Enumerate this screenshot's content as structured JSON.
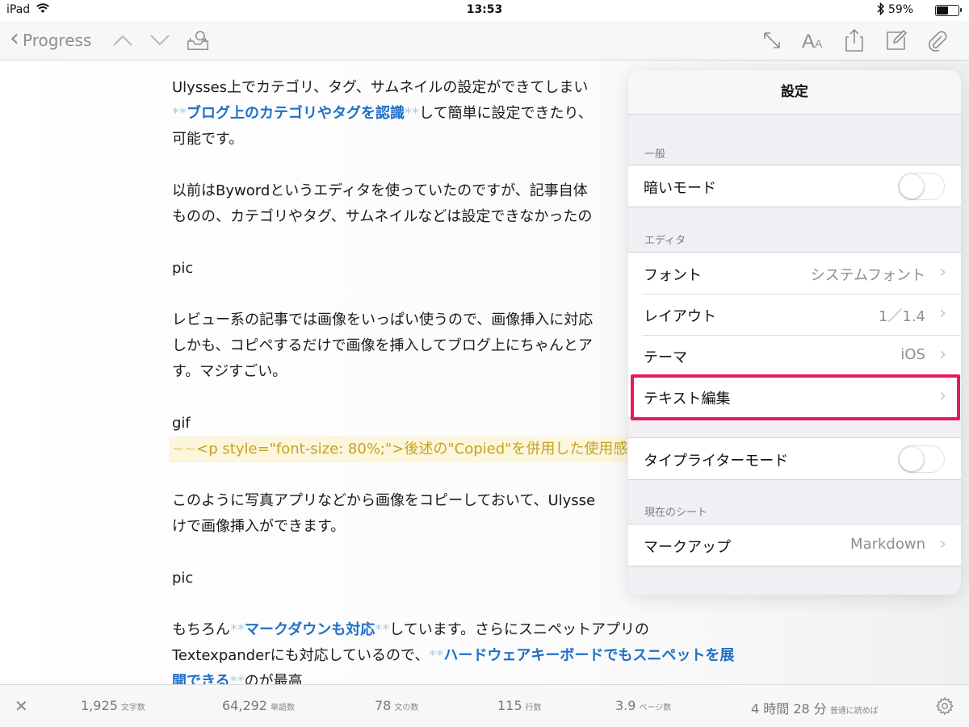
{
  "status_bar": {
    "device": "iPad",
    "time": "13:53",
    "battery": "59%",
    "battery_level": 0.59
  },
  "toolbar": {
    "back_label": "Progress",
    "icons": [
      "chevron-left-icon",
      "chevron-up-icon",
      "chevron-down-icon",
      "tray-search-icon",
      "expand-icon",
      "font-size-icon",
      "share-icon",
      "compose-icon",
      "attachment-icon"
    ]
  },
  "document": {
    "lines": {
      "l1": "Ulysses上でカテゴリ、タグ、サムネイルの設定ができてしまい",
      "l2_mk_open": "**",
      "l2_bold": "ブログ上のカテゴリやタグを認識",
      "l2_mk_close": "**",
      "l2_rest": "して簡単に設定できたり、",
      "l3": "可能です。",
      "l4": "以前はBywordというエディタを使っていたのですが、記事自体",
      "l5": "ものの、カテゴリやタグ、サムネイルなどは設定できなかったの",
      "l6": "pic",
      "l7": "レビュー系の記事では画像をいっぱい使うので、画像挿入に対応",
      "l8": "しかも、コピペするだけで画像を挿入してブログ上にちゃんとア",
      "l9": "す。マジすごい。",
      "l10": "gif",
      "l11_mk": "~~",
      "l11_code": "<p style=\"font-size: 80%;\">後述の\"Copied\"を併用した使用感",
      "l12": "このように写真アプリなどから画像をコピーしておいて、Ulysse",
      "l13": "けで画像挿入ができます。",
      "l14": "pic",
      "l15_a": "もちろん",
      "l15_mk_open": "**",
      "l15_bold": "マークダウンも対応",
      "l15_mk_close": "**",
      "l15_rest": "しています。さらにスニペットアプリの",
      "l16_a": "Textexpanderにも対応しているので、",
      "l16_mk_open": "**",
      "l16_bold": "ハードウェアキーボードでもスニペットを展",
      "l17_bold": "開できる",
      "l17_mk_close": "**",
      "l17_rest": "のが最高"
    }
  },
  "popover": {
    "title": "設定",
    "sections": {
      "general": {
        "header": "一般",
        "dark_mode_label": "暗いモード",
        "dark_mode_on": false
      },
      "editor": {
        "header": "エディタ",
        "font_label": "フォント",
        "font_value": "システムフォント",
        "layout_label": "レイアウト",
        "layout_value": "1／1.4",
        "theme_label": "テーマ",
        "theme_value": "iOS",
        "text_edit_label": "テキスト編集"
      },
      "typewriter": {
        "label": "タイプライターモード",
        "on": false
      },
      "current_sheet": {
        "header": "現在のシート",
        "markup_label": "マークアップ",
        "markup_value": "Markdown"
      }
    },
    "highlight_color": "#e8195e"
  },
  "footer": {
    "stats": [
      {
        "num": "1,925",
        "unit": "文字数"
      },
      {
        "num": "64,292",
        "unit": "単語数"
      },
      {
        "num": "78",
        "unit": "文の数"
      },
      {
        "num": "115",
        "unit": "行数"
      },
      {
        "num": "3.9",
        "unit": "ページ数"
      },
      {
        "num": "4 時間 28 分",
        "unit": "普通に読めば"
      }
    ]
  }
}
